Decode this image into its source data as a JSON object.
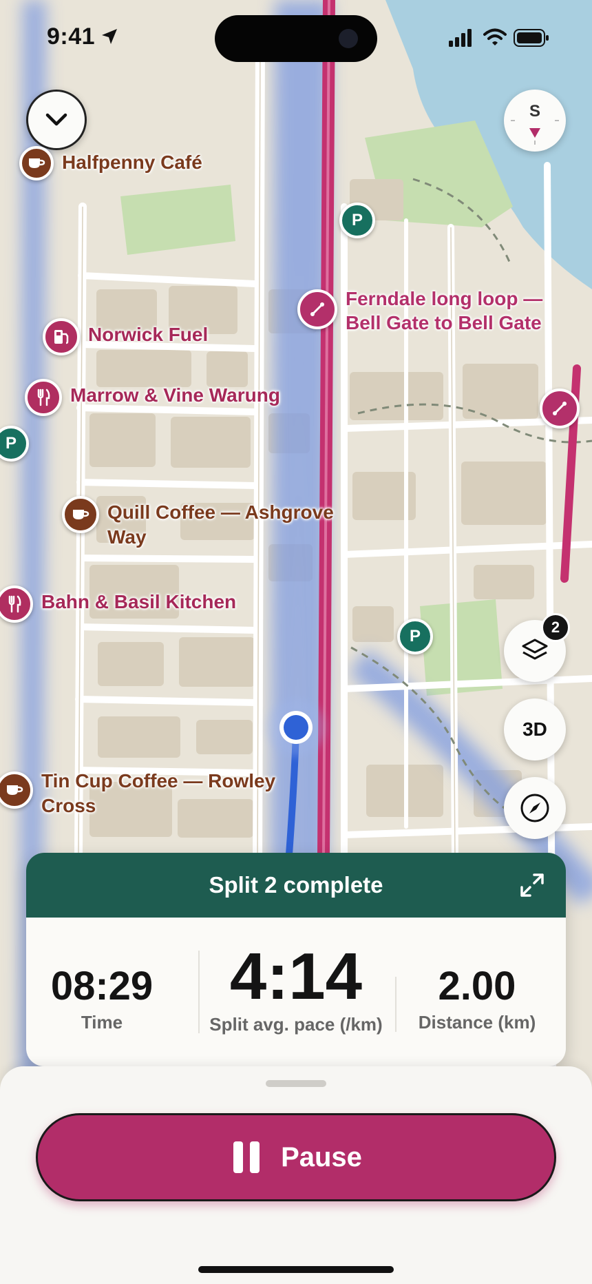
{
  "status_bar": {
    "time": "9:41"
  },
  "map": {
    "compass_letter": "S",
    "layers_badge": "2",
    "three_d_label": "3D",
    "pois": [
      {
        "type": "cafe",
        "label": "Halfpenny Café"
      },
      {
        "type": "fuel",
        "label": "Norwick Fuel"
      },
      {
        "type": "restaurant",
        "label": "Marrow & Vine Warung"
      },
      {
        "type": "cafe",
        "label": "Quill Coffee — Ashgrove Way"
      },
      {
        "type": "restaurant",
        "label": "Bahn & Basil Kitchen"
      },
      {
        "type": "cafe",
        "label": "Tin Cup Coffee — Rowley Cross"
      }
    ],
    "route_label": "Ferndale long loop — Bell Gate to Bell Gate",
    "parking_label": "P"
  },
  "split_card": {
    "title": "Split 2 complete",
    "time_value": "08:29",
    "time_caption": "Time",
    "pace_value": "4:14",
    "pace_caption": "Split avg. pace (/km)",
    "distance_value": "2.00",
    "distance_caption": "Distance (km)"
  },
  "controls": {
    "pause_label": "Pause"
  },
  "colors": {
    "accent": "#b22d69",
    "card_header": "#1e5c50",
    "route": "#c4316f",
    "parking": "#17705f",
    "cafe": "#7a3a1d"
  }
}
